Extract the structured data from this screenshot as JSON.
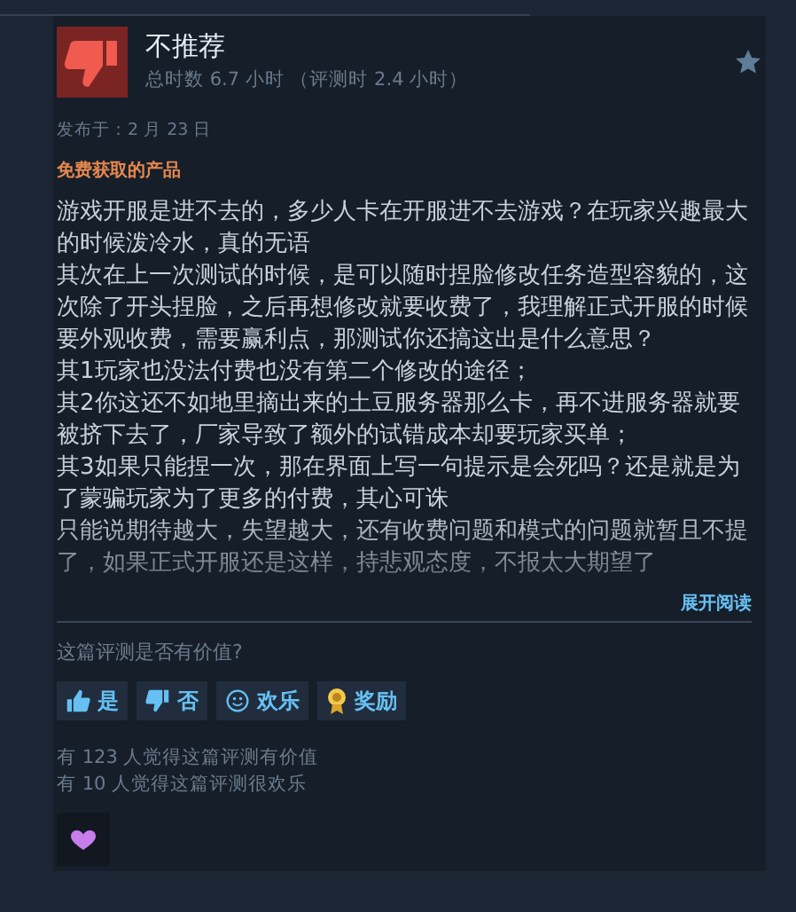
{
  "review": {
    "recommended": false,
    "verdict": "不推荐",
    "playtime": "总时数 6.7 小时 （评测时 2.4 小时）",
    "posted": "发布于：2 月 23 日",
    "product_note": "免费获取的产品",
    "paragraphs": [
      "游戏开服是进不去的，多少人卡在开服进不去游戏？在玩家兴趣最大的时候泼冷水，真的无语",
      "其次在上一次测试的时候，是可以随时捏脸修改任务造型容貌的，这次除了开头捏脸，之后再想修改就要收费了，我理解正式开服的时候要外观收费，需要赢利点，那测试你还搞这出是什么意思？",
      "其1玩家也没法付费也没有第二个修改的途径；",
      "其2你这还不如地里摘出来的土豆服务器那么卡，再不进服务器就要被挤下去了，厂家导致了额外的试错成本却要玩家买单；",
      "其3如果只能捏一次，那在界面上写一句提示是会死吗？还是就是为了蒙骗玩家为了更多的付费，其心可诛",
      "只能说期待越大，失望越大，还有收费问题和模式的问题就暂且不提了，如果正式开服还是这样，持悲观态度，不报太大期望了"
    ],
    "expand_link": "展开阅读"
  },
  "feedback": {
    "question": "这篇评测是否有价值?",
    "buttons": [
      {
        "kind": "yes",
        "label": "是"
      },
      {
        "kind": "no",
        "label": "否"
      },
      {
        "kind": "funny",
        "label": "欢乐"
      },
      {
        "kind": "award",
        "label": "奖励"
      }
    ],
    "counts": [
      "有 123 人觉得这篇评测有价值",
      "有 10 人觉得这篇评测很欢乐"
    ]
  }
}
